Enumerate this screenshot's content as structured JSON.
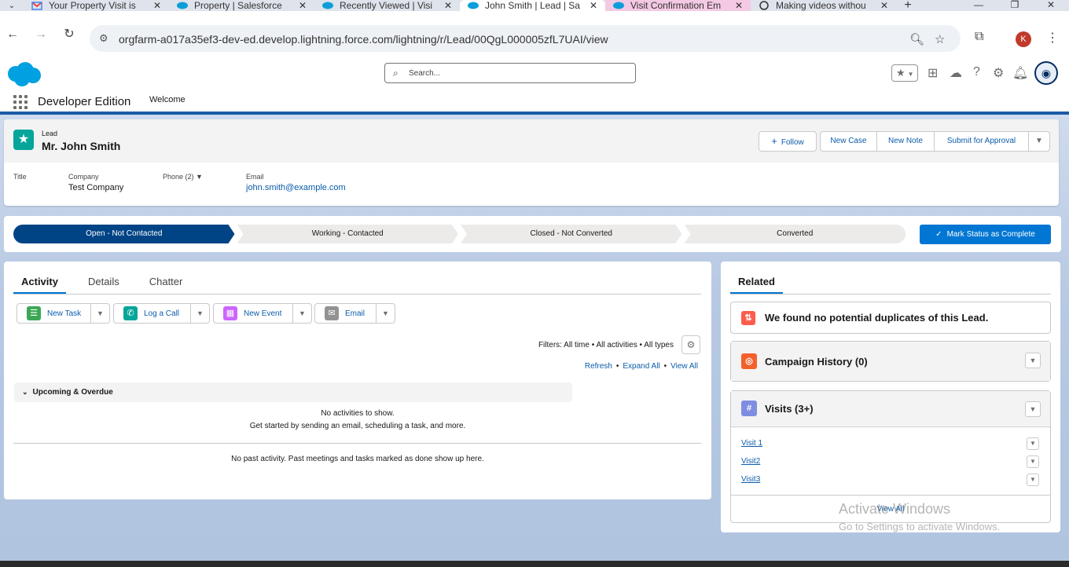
{
  "browser": {
    "tabs": [
      {
        "title": "Your Property Visit is",
        "icon": "gmail-icon"
      },
      {
        "title": "Property | Salesforce",
        "icon": "salesforce-cloud-icon"
      },
      {
        "title": "Recently Viewed | Visi",
        "icon": "salesforce-cloud-icon"
      },
      {
        "title": "John Smith | Lead | Sa",
        "icon": "salesforce-cloud-icon",
        "active": true
      },
      {
        "title": "Visit Confirmation Em",
        "icon": "salesforce-cloud-icon"
      },
      {
        "title": "Making videos withou",
        "icon": "openai-icon"
      }
    ],
    "url": "orgfarm-a017a35ef3-dev-ed.develop.lightning.force.com/lightning/r/Lead/00QgL000005zfL7UAI/view",
    "profile_initial": "K"
  },
  "sf": {
    "search_placeholder": "Search...",
    "app_name": "Developer Edition",
    "nav_item": "Welcome"
  },
  "record": {
    "object_label": "Lead",
    "title": "Mr. John Smith",
    "buttons": {
      "follow": "Follow",
      "new_case": "New Case",
      "new_note": "New Note",
      "submit": "Submit for Approval"
    },
    "fields": {
      "title_label": "Title",
      "company_label": "Company",
      "company_value": "Test Company",
      "phone_label": "Phone (2)",
      "email_label": "Email",
      "email_value": "john.smith@example.com"
    }
  },
  "path": {
    "stages": [
      "Open - Not Contacted",
      "Working - Contacted",
      "Closed - Not Converted",
      "Converted"
    ],
    "current": 0,
    "mark_button": "Mark Status as Complete"
  },
  "activity": {
    "tabs": [
      "Activity",
      "Details",
      "Chatter"
    ],
    "publishers": [
      "New Task",
      "Log a Call",
      "New Event",
      "Email"
    ],
    "filters": "Filters: All time • All activities • All types",
    "links": [
      "Refresh",
      "Expand All",
      "View All"
    ],
    "upcoming": "Upcoming & Overdue",
    "no_activities": "No activities to show.",
    "get_started": "Get started by sending an email, scheduling a task, and more.",
    "no_past": "No past activity. Past meetings and tasks marked as done show up here."
  },
  "related": {
    "tab": "Related",
    "duplicates": "We found no potential duplicates of this Lead.",
    "campaign": "Campaign History (0)",
    "visits": "Visits (3+)",
    "visit_items": [
      "Visit 1",
      "Visit2",
      "Visit3"
    ],
    "view_all": "View All"
  },
  "watermark": {
    "line1": "Activate Windows",
    "line2": "Go to Settings to activate Windows."
  },
  "colors": {
    "brand": "#0176d3",
    "path_current": "#014486",
    "lead_icon": "#06a59a"
  }
}
